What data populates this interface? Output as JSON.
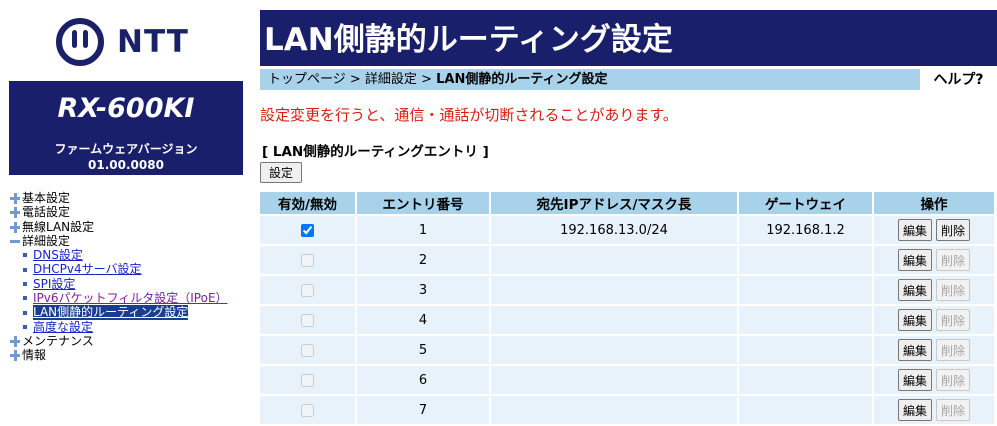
{
  "logo_text": "NTT",
  "model": "RX-600KI",
  "firmware_label": "ファームウェアバージョン",
  "firmware_version": "01.00.0080",
  "nav": {
    "basic": "基本設定",
    "phone": "電話設定",
    "wlan": "無線LAN設定",
    "detail": "詳細設定",
    "dns": "DNS設定",
    "dhcp": "DHCPv4サーバ設定",
    "spi": "SPI設定",
    "ipv6filter": "IPv6パケットフィルタ設定（IPoE）",
    "lanroute": "LAN側静的ルーティング設定",
    "advanced": "高度な設定",
    "maintenance": "メンテナンス",
    "info": "情報"
  },
  "page_title": "LAN側静的ルーティング設定",
  "breadcrumb": {
    "top": "トップページ",
    "sep": " > ",
    "detail": "詳細設定",
    "current": "LAN側静的ルーティング設定"
  },
  "help": "ヘルプ?",
  "warning": "設定変更を行うと、通信・通話が切断されることがあります。",
  "section_title": "[ LAN側静的ルーティングエントリ ]",
  "set_button": "設定",
  "table": {
    "headers": [
      "有効/無効",
      "エントリ番号",
      "宛先IPアドレス/マスク長",
      "ゲートウェイ",
      "操作"
    ],
    "edit_label": "編集",
    "delete_label": "削除",
    "rows": [
      {
        "enabled": true,
        "number": "1",
        "dest": "192.168.13.0/24",
        "gateway": "192.168.1.2",
        "delete_enabled": true
      },
      {
        "enabled": false,
        "number": "2",
        "dest": "",
        "gateway": "",
        "delete_enabled": false
      },
      {
        "enabled": false,
        "number": "3",
        "dest": "",
        "gateway": "",
        "delete_enabled": false
      },
      {
        "enabled": false,
        "number": "4",
        "dest": "",
        "gateway": "",
        "delete_enabled": false
      },
      {
        "enabled": false,
        "number": "5",
        "dest": "",
        "gateway": "",
        "delete_enabled": false
      },
      {
        "enabled": false,
        "number": "6",
        "dest": "",
        "gateway": "",
        "delete_enabled": false
      },
      {
        "enabled": false,
        "number": "7",
        "dest": "",
        "gateway": "",
        "delete_enabled": false
      }
    ]
  },
  "colors": {
    "brand_navy": "#1a1f6b",
    "header_blue": "#a8d2ea",
    "row_bg": "#e8f2fa",
    "warning_red": "#d91e18",
    "link_blue": "#1a23c9",
    "link_visited": "#7b1ea2"
  }
}
